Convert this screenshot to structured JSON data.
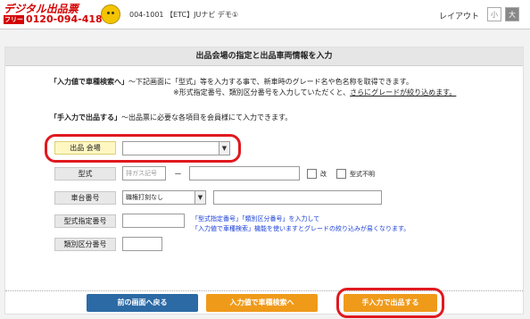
{
  "header": {
    "logo_top": "デジタル出品票",
    "logo_free": "フリー",
    "logo_phone": "0120-094-418",
    "shop_info": "004-1001 【ETC】JUナビ デモ①",
    "layout_label": "レイアウト",
    "size_small": "小",
    "size_large": "大"
  },
  "card": {
    "title": "出品会場の指定と出品車両情報を入力",
    "instructions": {
      "line1_label": "「入力値で車種検索へ」",
      "line1_text": "～下記画面に「型式」等を入力する事で、新車時のグレード名や色名称を取得できます。",
      "line2_text": "※形式指定番号、類別区分番号を入力していただくと、",
      "line2_link": "さらにグレードが絞り込めます。",
      "line3_label": "「手入力で出品する」",
      "line3_text": "～出品票に必要な各項目を会員様にて入力できます。"
    },
    "form": {
      "venue_label": "出品 会場",
      "venue_value": "",
      "model_label": "型式",
      "model_placeholder": "排ガス記号",
      "dash": "－",
      "check_kai": "改",
      "check_unknown": "型式不明",
      "chassis_label": "車台番号",
      "chassis_select": "職権打刻なし",
      "model_designation_label": "型式指定番号",
      "category_label": "類別区分番号",
      "note_line1": "「型式指定番号」「類別区分番号」を入力して",
      "note_line2": "「入力値で車種検索」機能を使いますとグレードの絞り込みが易くなります。"
    }
  },
  "buttons": {
    "back": "前の画面へ戻る",
    "search": "入力値で車種検索へ",
    "manual": "手入力で出品する"
  },
  "colors": {
    "accent_red": "#e0191f",
    "button_blue": "#2c6aa5",
    "button_orange": "#f09a1a",
    "note_blue": "#1a3fd6"
  }
}
